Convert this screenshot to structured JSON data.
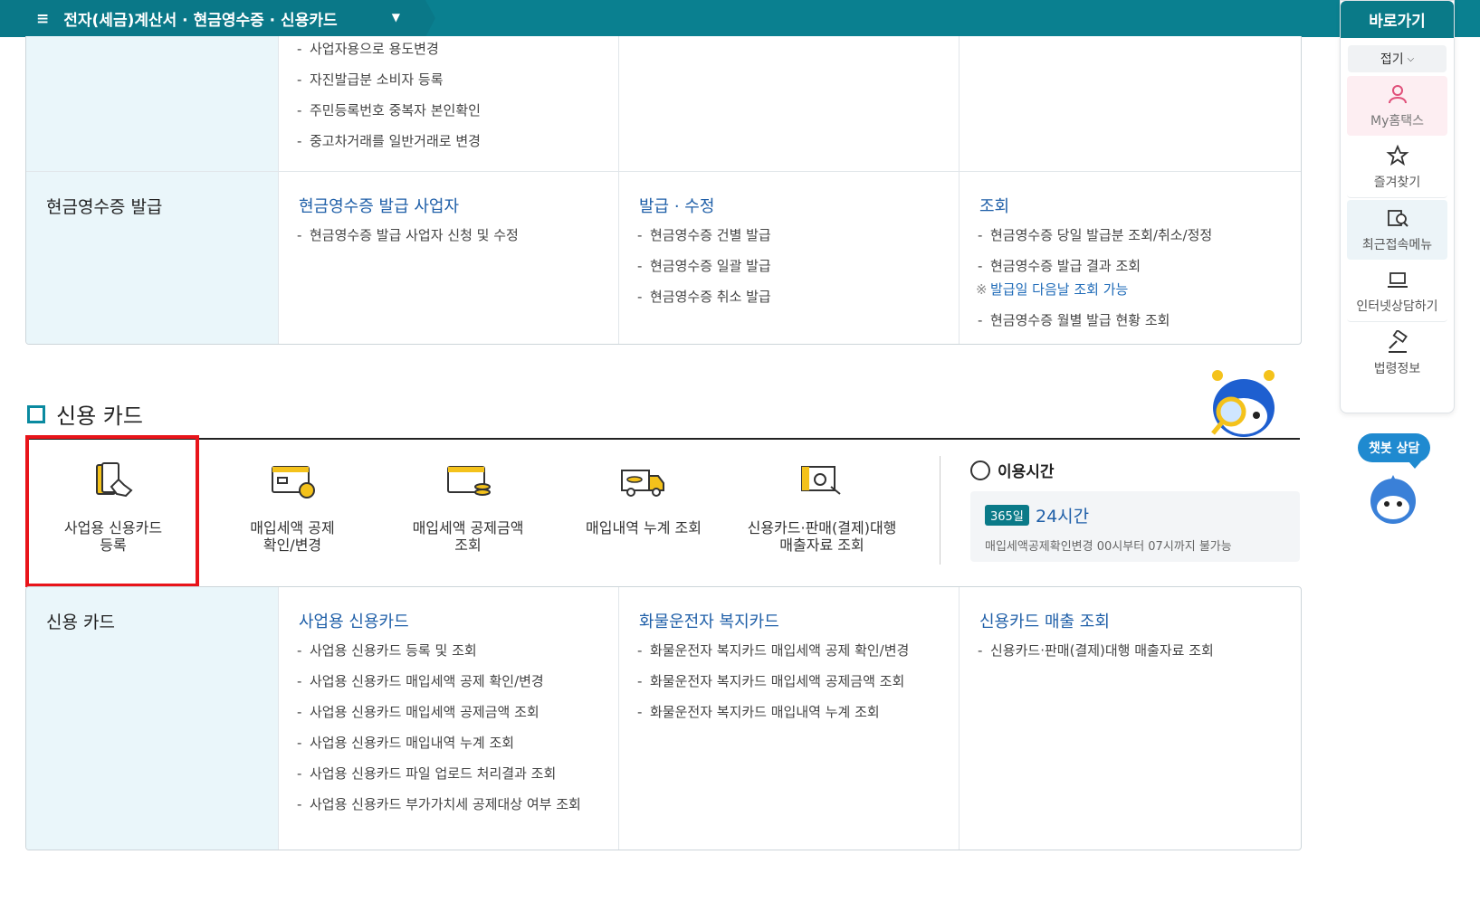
{
  "topbar": {
    "menu_icon": "hamburger-icon",
    "breadcrumb": "전자(세금)계산서 · 현금영수증 · 신용카드",
    "chevron": "chevron-down-icon"
  },
  "top_card": {
    "col1_items": [
      "사업자용으로 용도변경",
      "자진발급분 소비자 등록",
      "주민등록번호 중복자 본인확인",
      "중고차거래를 일반거래로 변경"
    ]
  },
  "cash_receipt": {
    "head": "현금영수증 발급",
    "cols": [
      {
        "title": "현금영수증 발급 사업자",
        "items": [
          "현금영수증 발급 사업자 신청 및 수정"
        ]
      },
      {
        "title": "발급 · 수정",
        "items": [
          "현금영수증 건별 발급",
          "현금영수증 일괄 발급",
          "현금영수증 취소 발급"
        ]
      },
      {
        "title": "조회",
        "items": [
          "현금영수증 당일 발급분 조회/취소/정정",
          "현금영수증 발급 결과 조회"
        ],
        "note": "발급일 다음날 조회 가능",
        "items_after": [
          "현금영수증 월별 발급 현황 조회"
        ]
      }
    ]
  },
  "credit_section": {
    "title": "신용 카드",
    "quick": [
      {
        "label": "사업용 신용카드\n등록",
        "icon": "card-register-icon"
      },
      {
        "label": "매입세액 공제\n확인/변경",
        "icon": "card-deduction-icon"
      },
      {
        "label": "매입세액 공제금액\n조회",
        "icon": "card-amount-icon"
      },
      {
        "label": "매입내역 누계 조회",
        "icon": "truck-icon"
      },
      {
        "label": "신용카드·판매(결제)대행\n매출자료 조회",
        "icon": "sales-data-icon"
      }
    ],
    "hours": {
      "title": "이용시간",
      "badge": "365일",
      "hours": "24시간",
      "note": "매입세액공제확인변경 00시부터 07시까지 불가능"
    },
    "card": {
      "head": "신용 카드",
      "cols": [
        {
          "title": "사업용 신용카드",
          "items": [
            "사업용 신용카드 등록 및 조회",
            "사업용 신용카드 매입세액 공제 확인/변경",
            "사업용 신용카드 매입세액 공제금액 조회",
            "사업용 신용카드 매입내역 누계 조회",
            "사업용 신용카드 파일 업로드 처리결과 조회",
            "사업용 신용카드 부가가치세 공제대상 여부 조회"
          ]
        },
        {
          "title": "화물운전자 복지카드",
          "items": [
            "화물운전자 복지카드 매입세액 공제 확인/변경",
            "화물운전자 복지카드 매입세액 공제금액 조회",
            "화물운전자 복지카드 매입내역 누계 조회"
          ]
        },
        {
          "title": "신용카드 매출 조회",
          "items": [
            "신용카드·판매(결제)대행 매출자료 조회"
          ]
        }
      ]
    }
  },
  "right_panel": {
    "title": "바로가기",
    "fold": "접기",
    "items": [
      {
        "label": "My홈택스",
        "icon": "person-icon"
      },
      {
        "label": "즐겨찾기",
        "icon": "star-icon"
      },
      {
        "label": "최근접속메뉴",
        "icon": "recent-menu-icon"
      },
      {
        "label": "인터넷상담하기",
        "icon": "laptop-icon"
      },
      {
        "label": "법령정보",
        "icon": "gavel-icon"
      }
    ],
    "chat": "챗봇 상담"
  }
}
